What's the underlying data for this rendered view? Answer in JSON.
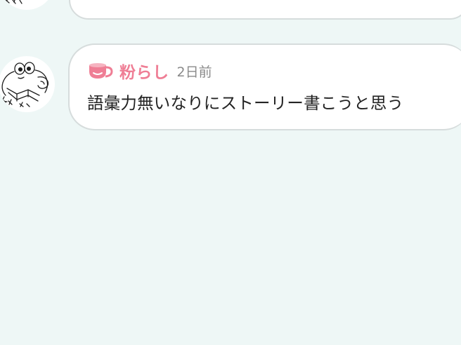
{
  "colors": {
    "background": "#eef7f6",
    "bubble": "#ffffff",
    "bubble_border": "#d6dcdc",
    "username": "#ef7e95",
    "timestamp": "#8a8a8a",
    "message_text": "#232323"
  },
  "posts": [
    {
      "avatar_icon": "frog-sketch-avatar"
    },
    {
      "avatar_icon": "frog-sketch-avatar",
      "badge_icon": "teacup-icon",
      "username": "粉らし",
      "timestamp": "2日前",
      "message": "語彙力無いなりにストーリー書こうと思う"
    }
  ]
}
